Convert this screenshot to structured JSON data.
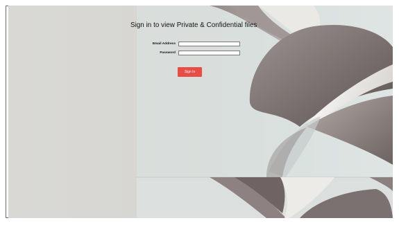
{
  "page": {
    "heading": "Sign in to view Private & Confidential files"
  },
  "form": {
    "email_label": "Email Address",
    "email_value": "",
    "password_label": "Password",
    "password_value": "",
    "signin_label": "Sign In"
  },
  "colors": {
    "button": "#e74d45",
    "background_left": "#d9d8d5",
    "background_right": "#dde3e1",
    "shape_dark": "#7c706e",
    "shape_light": "#efeeea"
  }
}
